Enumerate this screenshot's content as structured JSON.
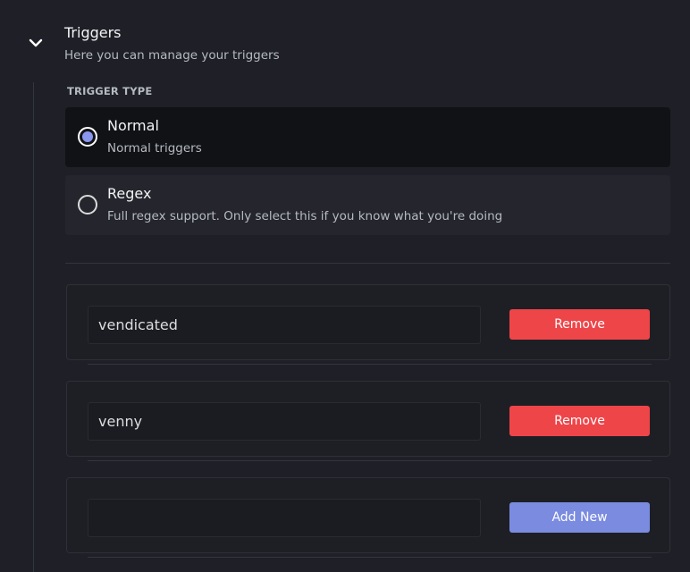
{
  "section": {
    "title": "Triggers",
    "subtitle": "Here you can manage your triggers",
    "toggle_icon": "chevron-down-icon"
  },
  "trigger_type": {
    "label": "TRIGGER TYPE",
    "options": [
      {
        "title": "Normal",
        "description": "Normal triggers",
        "selected": true
      },
      {
        "title": "Regex",
        "description": "Full regex support. Only select this if you know what you're doing",
        "selected": false
      }
    ]
  },
  "triggers": {
    "rows": [
      {
        "value": "vendicated",
        "button_label": "Remove"
      },
      {
        "value": "venny",
        "button_label": "Remove"
      },
      {
        "value": "",
        "button_label": "Add New"
      }
    ]
  },
  "colors": {
    "accent": "#8a97ee",
    "remove_button": "#ee4549",
    "add_button": "#7a8be0",
    "background": "#1f2027"
  }
}
